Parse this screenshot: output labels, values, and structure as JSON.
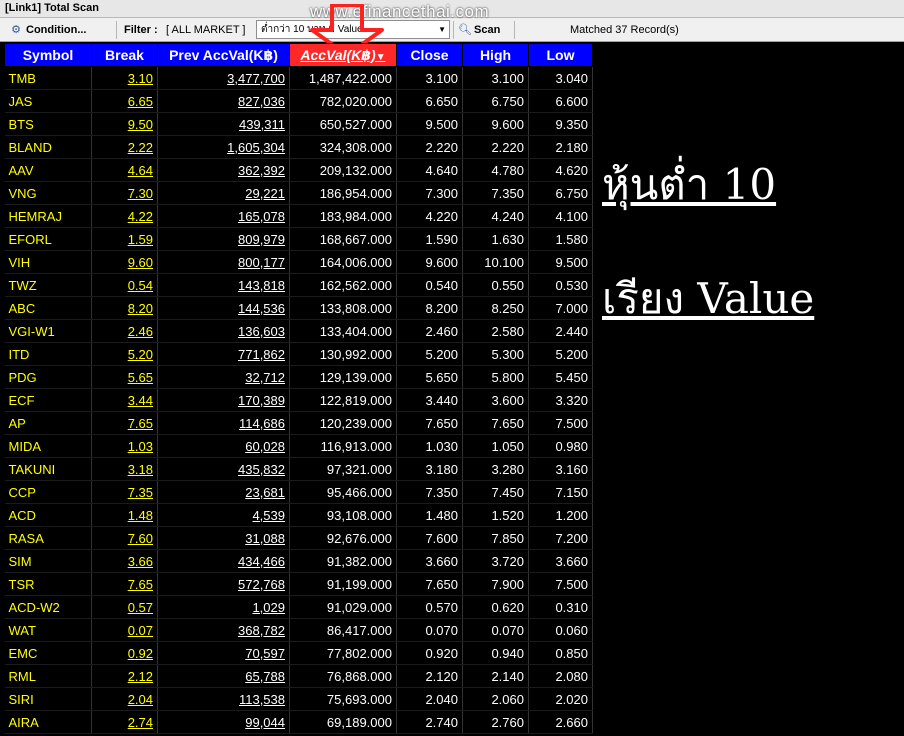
{
  "window": {
    "title": "[Link1] Total Scan"
  },
  "toolbar": {
    "condition_label": "Condition...",
    "filter_label": "Filter :",
    "filter_value": "[ ALL MARKET ]",
    "combo_value": "ต่ำกว่า  10  บาท  มี  Value",
    "scan_label": "Scan",
    "matched_text": "Matched 37 Record(s)"
  },
  "watermark": "www.efinancethai.com",
  "columns": [
    "Symbol",
    "Break",
    "Prev AccVal(K฿)",
    "AccVal(K฿)",
    "Close",
    "High",
    "Low"
  ],
  "sort_indicator": "▼",
  "rows": [
    [
      "TMB",
      "3.10",
      "3,477,700",
      "1,487,422.000",
      "3.100",
      "3.100",
      "3.040"
    ],
    [
      "JAS",
      "6.65",
      "827,036",
      "782,020.000",
      "6.650",
      "6.750",
      "6.600"
    ],
    [
      "BTS",
      "9.50",
      "439,311",
      "650,527.000",
      "9.500",
      "9.600",
      "9.350"
    ],
    [
      "BLAND",
      "2.22",
      "1,605,304",
      "324,308.000",
      "2.220",
      "2.220",
      "2.180"
    ],
    [
      "AAV",
      "4.64",
      "362,392",
      "209,132.000",
      "4.640",
      "4.780",
      "4.620"
    ],
    [
      "VNG",
      "7.30",
      "29,221",
      "186,954.000",
      "7.300",
      "7.350",
      "6.750"
    ],
    [
      "HEMRAJ",
      "4.22",
      "165,078",
      "183,984.000",
      "4.220",
      "4.240",
      "4.100"
    ],
    [
      "EFORL",
      "1.59",
      "809,979",
      "168,667.000",
      "1.590",
      "1.630",
      "1.580"
    ],
    [
      "VIH",
      "9.60",
      "800,177",
      "164,006.000",
      "9.600",
      "10.100",
      "9.500"
    ],
    [
      "TWZ",
      "0.54",
      "143,818",
      "162,562.000",
      "0.540",
      "0.550",
      "0.530"
    ],
    [
      "ABC",
      "8.20",
      "144,536",
      "133,808.000",
      "8.200",
      "8.250",
      "7.000"
    ],
    [
      "VGI-W1",
      "2.46",
      "136,603",
      "133,404.000",
      "2.460",
      "2.580",
      "2.440"
    ],
    [
      "ITD",
      "5.20",
      "771,862",
      "130,992.000",
      "5.200",
      "5.300",
      "5.200"
    ],
    [
      "PDG",
      "5.65",
      "32,712",
      "129,139.000",
      "5.650",
      "5.800",
      "5.450"
    ],
    [
      "ECF",
      "3.44",
      "170,389",
      "122,819.000",
      "3.440",
      "3.600",
      "3.320"
    ],
    [
      "AP",
      "7.65",
      "114,686",
      "120,239.000",
      "7.650",
      "7.650",
      "7.500"
    ],
    [
      "MIDA",
      "1.03",
      "60,028",
      "116,913.000",
      "1.030",
      "1.050",
      "0.980"
    ],
    [
      "TAKUNI",
      "3.18",
      "435,832",
      "97,321.000",
      "3.180",
      "3.280",
      "3.160"
    ],
    [
      "CCP",
      "7.35",
      "23,681",
      "95,466.000",
      "7.350",
      "7.450",
      "7.150"
    ],
    [
      "ACD",
      "1.48",
      "4,539",
      "93,108.000",
      "1.480",
      "1.520",
      "1.200"
    ],
    [
      "RASA",
      "7.60",
      "31,088",
      "92,676.000",
      "7.600",
      "7.850",
      "7.200"
    ],
    [
      "SIM",
      "3.66",
      "434,466",
      "91,382.000",
      "3.660",
      "3.720",
      "3.660"
    ],
    [
      "TSR",
      "7.65",
      "572,768",
      "91,199.000",
      "7.650",
      "7.900",
      "7.500"
    ],
    [
      "ACD-W2",
      "0.57",
      "1,029",
      "91,029.000",
      "0.570",
      "0.620",
      "0.310"
    ],
    [
      "WAT",
      "0.07",
      "368,782",
      "86,417.000",
      "0.070",
      "0.070",
      "0.060"
    ],
    [
      "EMC",
      "0.92",
      "70,597",
      "77,802.000",
      "0.920",
      "0.940",
      "0.850"
    ],
    [
      "RML",
      "2.12",
      "65,788",
      "76,868.000",
      "2.120",
      "2.140",
      "2.080"
    ],
    [
      "SIRI",
      "2.04",
      "113,538",
      "75,693.000",
      "2.040",
      "2.060",
      "2.020"
    ],
    [
      "AIRA",
      "2.74",
      "99,044",
      "69,189.000",
      "2.740",
      "2.760",
      "2.660"
    ]
  ],
  "annotation": {
    "line1": "หุ้นต่ำ 10",
    "line2": "เรียง Value"
  },
  "colors": {
    "header_bg": "#0000ff",
    "active_header_bg": "#ff2828",
    "symbol_text": "#ffff00",
    "value_text": "#ffffff",
    "grid_bg": "#000000"
  }
}
